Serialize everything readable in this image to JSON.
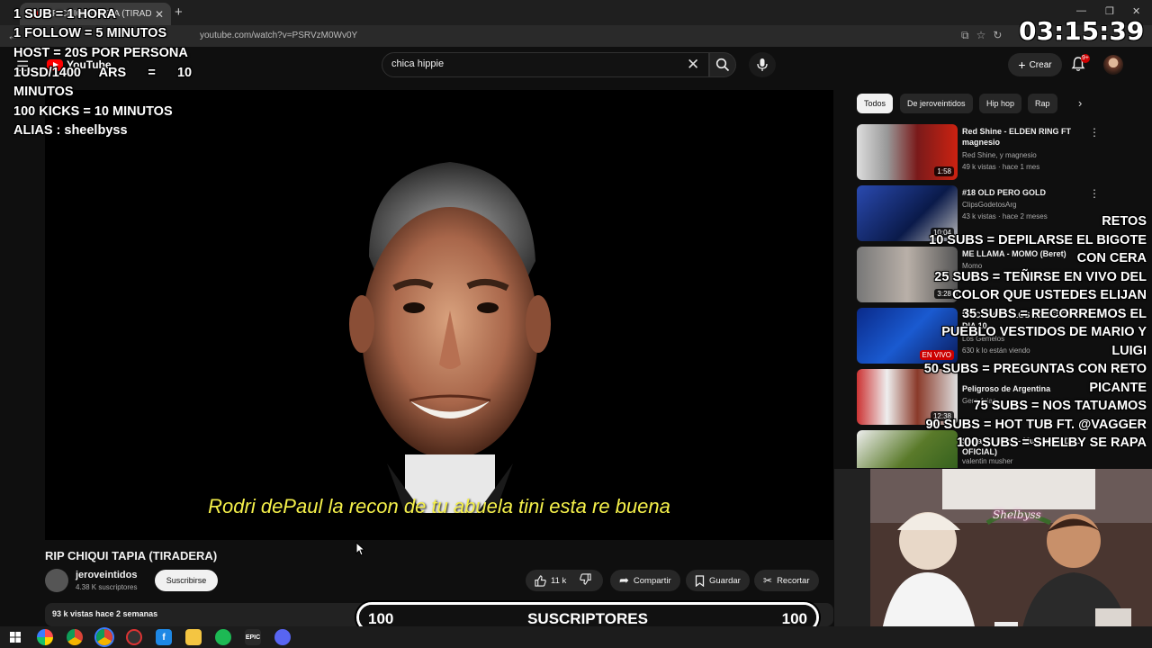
{
  "browser": {
    "tab_title": "RIP CHIQUI TAPIA (TIRADERA)",
    "url": "youtube.com/watch?v=PSRVzM0Wv0Y"
  },
  "youtube": {
    "logo": "YouTube",
    "search_value": "chica hippie",
    "create_label": "Crear",
    "notification_count": "9+"
  },
  "video": {
    "subtitle": "Rodri dePaul la recon de tu abuela tini esta re buena",
    "title": "RIP CHIQUI TAPIA (TIRADERA)",
    "channel": "jeroveintidos",
    "channel_subs": "4.38 K suscriptores",
    "subscribe_label": "Suscribirse",
    "likes": "11 k",
    "share_label": "Compartir",
    "save_label": "Guardar",
    "clip_label": "Recortar",
    "meta": "93 k vistas  hace 2 semanas"
  },
  "chips": [
    "Todos",
    "De jeroveintidos",
    "Hip hop",
    "Rap"
  ],
  "recommendations": [
    {
      "title": "Red Shine - ELDEN RING FT magnesio",
      "channel": "Red Shine, y magnesio",
      "stats": "49 k vistas · hace 1 mes",
      "duration": "1:58",
      "thumb_color": "#7a1a1a"
    },
    {
      "title": "#18 OLD PERO GOLD",
      "channel": "ClipsGodetosArg",
      "stats": "43 k vistas · hace 2 meses",
      "duration": "10:04",
      "thumb_color": "#1e3a7a"
    },
    {
      "title": "ME LLAMA - MOMO (Beret)",
      "channel": "Momo",
      "stats": "",
      "duration": "3:28",
      "thumb_color": "#6a6a6a"
    },
    {
      "title": "LA CASA DE LOS GEMELOS 2 DIA 10",
      "channel": "Los Gemelos",
      "stats": "630 k lo están viendo",
      "duration": "EN VIVO",
      "thumb_color": "#123a8a"
    },
    {
      "title": "Peligroso de Argentina",
      "channel": "Gero Arias",
      "stats": "",
      "duration": "12:38",
      "thumb_color": "#8a3a2a"
    },
    {
      "title": "Sopa de Rana - Musher (VIDEO OFICIAL)",
      "channel": "valentin musher",
      "stats": "",
      "duration": "",
      "thumb_color": "#5a7a2a"
    }
  ],
  "overlays": {
    "top_lines": [
      "1 SUB = 1 HORA",
      "1 FOLLOW = 5 MINUTOS"
    ],
    "left_lines": [
      "HOST = 20S POR PERSONA",
      "1USD/1400     ARS      =      10",
      "MINUTOS",
      "100 KICKS = 10 MINUTOS",
      "ALIAS : sheelbyss"
    ],
    "clock": "03:15:39",
    "retos_lines": [
      "RETOS",
      "10 SUBS = DEPILARSE EL BIGOTE",
      "CON CERA",
      "25 SUBS = TEÑIRSE EN VIVO DEL",
      "COLOR QUE USTEDES ELIJAN",
      "35 SUBS = RECORREMOS EL",
      "PUEBLO VESTIDOS DE MARIO Y",
      "LUIGI",
      "50 SUBS = PREGUNTAS CON RETO",
      "PICANTE",
      "75 SUBS = NOS TATUAMOS",
      "90 SUBS  = HOT TUB FT. @VAGGER",
      "100 SUBS = SHELBY SE RAPA"
    ],
    "webcam_sign": "Shelbyss"
  },
  "goal": {
    "left": "100",
    "center": "SUSCRIPTORES",
    "right": "100",
    "progress": 1.0
  },
  "colors": {
    "accent": "#ff0000",
    "subtitle": "#f5f04a",
    "background": "#0f0f0f"
  }
}
